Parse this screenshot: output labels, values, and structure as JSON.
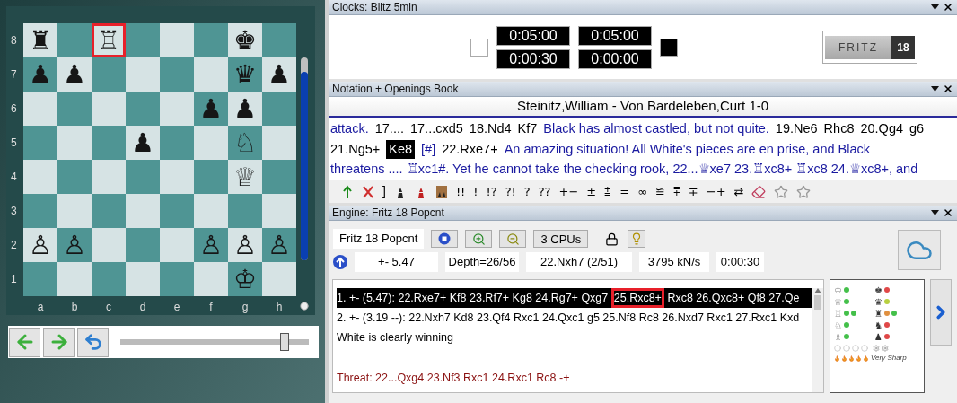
{
  "board": {
    "rank_labels": [
      "8",
      "7",
      "6",
      "5",
      "4",
      "3",
      "2",
      "1"
    ],
    "file_labels": [
      "a",
      "b",
      "c",
      "d",
      "e",
      "f",
      "g",
      "h"
    ],
    "ranks": [
      [
        {
          "glyph": "♜",
          "marked": false
        },
        {
          "marked": false
        },
        {
          "glyph": "♖",
          "marked": true
        },
        {
          "marked": false
        },
        {
          "marked": false
        },
        {
          "marked": false
        },
        {
          "glyph": "♚",
          "marked": false
        },
        {
          "marked": false
        }
      ],
      [
        {
          "glyph": "♟",
          "marked": false
        },
        {
          "glyph": "♟",
          "marked": false
        },
        {
          "marked": false
        },
        {
          "marked": false
        },
        {
          "marked": false
        },
        {
          "marked": false
        },
        {
          "glyph": "♛",
          "marked": false
        },
        {
          "glyph": "♟",
          "marked": false
        }
      ],
      [
        {
          "marked": false
        },
        {
          "marked": false
        },
        {
          "marked": false
        },
        {
          "marked": false
        },
        {
          "marked": false
        },
        {
          "glyph": "♟",
          "marked": false
        },
        {
          "glyph": "♟",
          "marked": false
        },
        {
          "marked": false
        }
      ],
      [
        {
          "marked": false
        },
        {
          "marked": false
        },
        {
          "marked": false
        },
        {
          "glyph": "♟",
          "marked": false
        },
        {
          "marked": false
        },
        {
          "marked": false
        },
        {
          "glyph": "♘",
          "marked": false
        },
        {
          "marked": false
        }
      ],
      [
        {
          "marked": false
        },
        {
          "marked": false
        },
        {
          "marked": false
        },
        {
          "marked": false
        },
        {
          "marked": false
        },
        {
          "marked": false
        },
        {
          "glyph": "♕",
          "marked": false
        },
        {
          "marked": false
        }
      ],
      [
        {
          "marked": false
        },
        {
          "marked": false
        },
        {
          "marked": false
        },
        {
          "marked": false
        },
        {
          "marked": false
        },
        {
          "marked": false
        },
        {
          "marked": false
        },
        {
          "marked": false
        }
      ],
      [
        {
          "glyph": "♙",
          "marked": false
        },
        {
          "glyph": "♙",
          "marked": false
        },
        {
          "marked": false
        },
        {
          "marked": false
        },
        {
          "marked": false
        },
        {
          "glyph": "♙",
          "marked": false
        },
        {
          "glyph": "♙",
          "marked": false
        },
        {
          "glyph": "♙",
          "marked": false
        }
      ],
      [
        {
          "marked": false
        },
        {
          "marked": false
        },
        {
          "marked": false
        },
        {
          "marked": false
        },
        {
          "marked": false
        },
        {
          "marked": false
        },
        {
          "glyph": "♔",
          "marked": false
        },
        {
          "marked": false
        }
      ]
    ],
    "eval_bar": {
      "level": 0.93
    }
  },
  "move_slider": {
    "level": 0.87
  },
  "clocks": {
    "title": "Clocks: Blitz 5min",
    "white": {
      "time": "0:05:00",
      "increment": "0:00:30",
      "to_move": false
    },
    "black": {
      "time": "0:05:00",
      "increment": "0:00:00",
      "to_move": true
    },
    "logo": {
      "name": "FRITZ",
      "version": "18"
    }
  },
  "notation": {
    "title": "Notation + Openings Book",
    "game": "Steinitz,William - Von Bardeleben,Curt  1-0",
    "lines": [
      [
        {
          "kind": "comment",
          "text": "attack."
        },
        {
          "kind": "move",
          "text": "17...."
        },
        {
          "kind": "move",
          "text": "17...cxd5"
        },
        {
          "kind": "move",
          "text": "18.Nd4"
        },
        {
          "kind": "move",
          "text": "Kf7"
        },
        {
          "kind": "comment",
          "text": "Black has almost castled, but not quite."
        },
        {
          "kind": "move",
          "text": "19.Ne6"
        },
        {
          "kind": "move",
          "text": "Rhc8"
        },
        {
          "kind": "move",
          "text": "20.Qg4"
        },
        {
          "kind": "move",
          "text": "g6"
        }
      ],
      [
        {
          "kind": "move",
          "text": "21.Ng5+"
        },
        {
          "kind": "current",
          "text": "Ke8"
        },
        {
          "kind": "comment",
          "text": "[#]"
        },
        {
          "kind": "move",
          "text": "22.Rxe7+"
        },
        {
          "kind": "comment",
          "text": "An amazing situation! All White's pieces are en prise, and Black"
        }
      ],
      [
        {
          "kind": "comment",
          "text": "threatens .... ♖xc1#. Yet he cannot take the checking rook, 22...♕xe7 23.♖xc8+ ♖xc8 24.♕xc8+, and"
        }
      ]
    ],
    "symbols": [
      "]",
      "!!",
      "!",
      "!?",
      "?!",
      "?",
      "??",
      "+−",
      "±",
      "⩲",
      "=",
      "∞",
      "≌",
      "⩱",
      "∓",
      "−+",
      "⇄"
    ]
  },
  "engine": {
    "title": "Engine: Fritz 18 Popcnt",
    "name": "Fritz 18 Popcnt",
    "cpus": "3 CPUs",
    "evaluation": "+- 5.47",
    "depth": "Depth=26/56",
    "current_move": "22.Nxh7 (2/51)",
    "speed": "3795 kN/s",
    "time": "0:00:30",
    "lines": [
      {
        "kind": "variation",
        "selected": true,
        "parts": [
          {
            "text": "1. +- (5.47): 22.Rxe7+ Kf8 23.Rf7+ Kg8 24.Rg7+ Qxg7 ",
            "marked": false
          },
          {
            "text": "25.Rxc8+",
            "marked": true
          },
          {
            "text": " Rxc8 26.Qxc8+ Qf8 27.Qe",
            "marked": false
          }
        ]
      },
      {
        "kind": "variation",
        "selected": false,
        "parts": [
          {
            "text": "2. +- (3.19 --): 22.Nxh7 Kd8 23.Qf4 Rxc1 24.Qxc1 g5 25.Nf8 Rc8 26.Nxd7 Rxc1 27.Rxc1 Kxd",
            "marked": false
          }
        ]
      },
      {
        "kind": "verdict",
        "selected": false,
        "parts": [
          {
            "text": "White is clearly winning",
            "marked": false
          }
        ]
      },
      {
        "kind": "threat",
        "selected": false,
        "parts": [
          {
            "text": "Threat: 22...Qxg4 23.Nf3 Rxc1 24.Rxc1 Rc8 -+",
            "marked": false
          }
        ]
      }
    ],
    "activity": {
      "rows": [
        {
          "white_glyph": "♔",
          "white_dots": [
            {
              "color": "#44c04a"
            }
          ],
          "black_glyph": "♚",
          "black_dots": [
            {
              "color": "#e04848"
            }
          ]
        },
        {
          "white_glyph": "♕",
          "white_dots": [
            {
              "color": "#44c04a"
            }
          ],
          "black_glyph": "♛",
          "black_dots": [
            {
              "color": "#b8d040"
            }
          ]
        },
        {
          "white_glyph": "♖",
          "white_dots": [
            {
              "color": "#44c04a"
            },
            {
              "color": "#44c04a"
            }
          ],
          "black_glyph": "♜",
          "black_dots": [
            {
              "color": "#e09040"
            },
            {
              "color": "#44c04a"
            }
          ]
        },
        {
          "white_glyph": "♘",
          "white_dots": [
            {
              "color": "#44c04a"
            }
          ],
          "black_glyph": "♞",
          "black_dots": [
            {
              "color": "#e04848"
            }
          ]
        },
        {
          "white_glyph": "♗",
          "white_dots": [
            {
              "color": "#44c04a"
            }
          ],
          "black_glyph": "♟",
          "black_dots": [
            {
              "color": "#e04848"
            }
          ]
        }
      ],
      "sharpness": "Very Sharp"
    }
  }
}
